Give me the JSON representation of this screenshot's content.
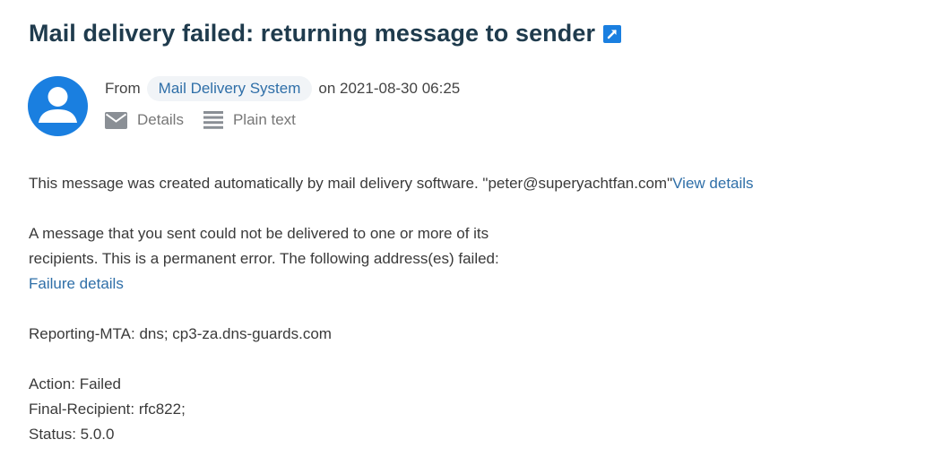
{
  "email": {
    "subject": "Mail delivery failed: returning message to sender",
    "from_label": "From",
    "sender": "Mail Delivery System",
    "date_text": "on 2021-08-30 06:25",
    "actions": {
      "details": "Details",
      "plain_text": "Plain text"
    }
  },
  "body": {
    "intro": "This message was created automatically by mail delivery software. \"peter@superyachtfan.com\"",
    "view_details": "View details",
    "failure_line1": "A message that you sent could not be delivered to one or more of its",
    "failure_line2": "recipients. This is a permanent error. The following address(es) failed:",
    "failure_details": "Failure details",
    "reporting_mta": "Reporting-MTA: dns; cp3-za.dns-guards.com",
    "action": "Action: Failed",
    "final_recipient": "Final-Recipient: rfc822;",
    "status": "Status: 5.0.0"
  },
  "colors": {
    "title": "#1f3b4d",
    "link": "#2f6fa8",
    "avatar": "#1a7fe0",
    "chip_bg": "#f1f4f7"
  },
  "icons": {
    "external": "external-link-icon",
    "avatar": "user-avatar-icon",
    "details": "envelope-icon",
    "plain_text": "list-lines-icon"
  }
}
